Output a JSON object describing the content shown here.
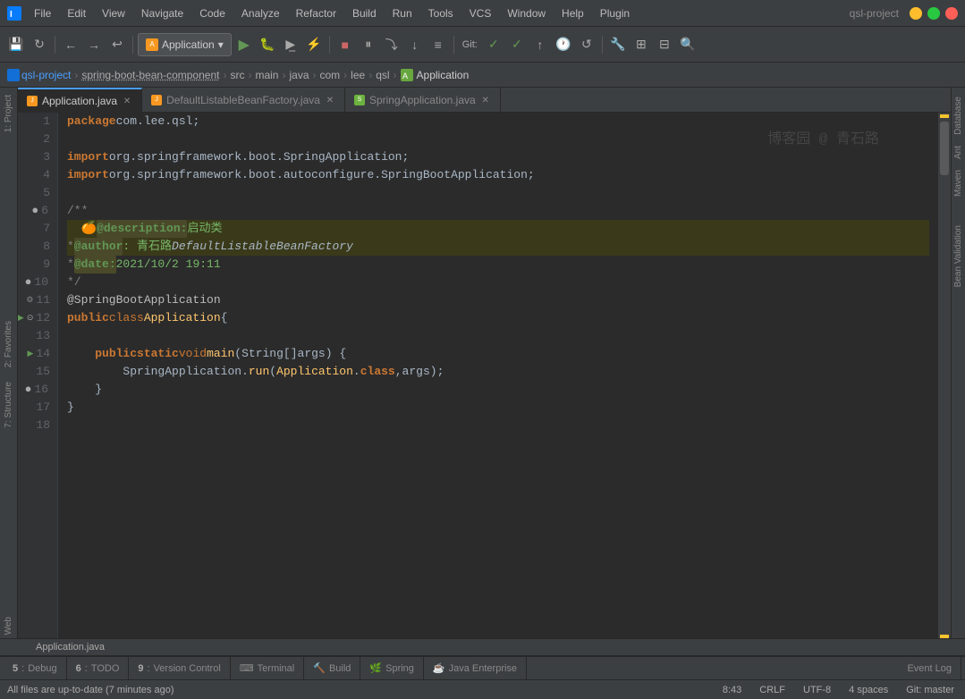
{
  "titlebar": {
    "project_name": "qsl-project",
    "menu": [
      "File",
      "Edit",
      "View",
      "Navigate",
      "Code",
      "Analyze",
      "Refactor",
      "Build",
      "Run",
      "Tools",
      "VCS",
      "Window",
      "Help",
      "Plugin"
    ]
  },
  "toolbar": {
    "run_config": "Application",
    "git_status": "Git:",
    "buttons": [
      "save-all",
      "sync",
      "back",
      "forward",
      "undo",
      "run-config-dropdown",
      "run",
      "resume",
      "step-over",
      "step-into",
      "force-step",
      "evaluate",
      "stop",
      "build",
      "build-project",
      "coverage",
      "profile",
      "search"
    ]
  },
  "breadcrumb": {
    "items": [
      "qsl-project",
      "spring-boot-bean-component",
      "src",
      "main",
      "java",
      "com",
      "lee",
      "qsl",
      "Application"
    ]
  },
  "tabs": [
    {
      "label": "Application.java",
      "type": "java",
      "active": true
    },
    {
      "label": "DefaultListableBeanFactory.java",
      "type": "java",
      "active": false
    },
    {
      "label": "SpringApplication.java",
      "type": "spring",
      "active": false
    }
  ],
  "editor": {
    "watermark": "博客园 @ 青石路",
    "lines": [
      {
        "num": 1,
        "content": "package com.lee.qsl;"
      },
      {
        "num": 2,
        "content": ""
      },
      {
        "num": 3,
        "content": "import org.springframework.boot.SpringApplication;"
      },
      {
        "num": 4,
        "content": "import org.springframework.boot.autoconfigure.SpringBootApplication;"
      },
      {
        "num": 5,
        "content": ""
      },
      {
        "num": 6,
        "content": "/**"
      },
      {
        "num": 7,
        "content": "  @description: 启动类"
      },
      {
        "num": 8,
        "content": " * @author : 青石路DefaultListableBeanFactory"
      },
      {
        "num": 9,
        "content": " * @date: 2021/10/2 19:11"
      },
      {
        "num": 10,
        "content": " */"
      },
      {
        "num": 11,
        "content": "@SpringBootApplication"
      },
      {
        "num": 12,
        "content": "public class Application {"
      },
      {
        "num": 13,
        "content": ""
      },
      {
        "num": 14,
        "content": "    public static void main(String[] args) {"
      },
      {
        "num": 15,
        "content": "        SpringApplication.run(Application.class, args);"
      },
      {
        "num": 16,
        "content": "    }"
      },
      {
        "num": 17,
        "content": "}"
      },
      {
        "num": 18,
        "content": ""
      }
    ]
  },
  "right_panel": {
    "tabs": [
      "Database",
      "Ant",
      "Maven",
      "Bean Validation"
    ]
  },
  "bottom_tabs": [
    {
      "num": "5",
      "label": "Debug"
    },
    {
      "num": "6",
      "label": "TODO"
    },
    {
      "num": "9",
      "label": "Version Control"
    },
    {
      "num": "",
      "label": "Terminal"
    },
    {
      "num": "",
      "label": "Build"
    },
    {
      "num": "",
      "label": "Spring"
    },
    {
      "num": "",
      "label": "Java Enterprise"
    }
  ],
  "status_bar": {
    "left": "All files are up-to-date (7 minutes ago)",
    "time": "8:43",
    "line_ending": "CRLF",
    "encoding": "UTF-8",
    "indent": "4 spaces",
    "git": "Git: master",
    "event_log": "Event Log"
  }
}
